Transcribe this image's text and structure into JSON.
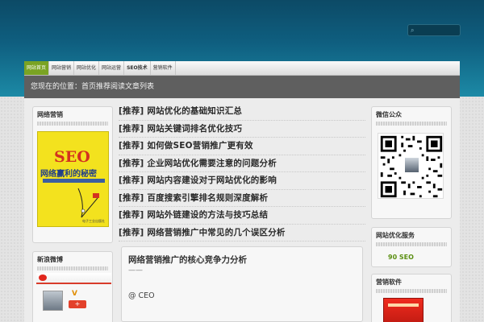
{
  "search": {
    "placeholder": "",
    "icon": "search-icon"
  },
  "nav": {
    "items": [
      {
        "label": "网站首页",
        "active": true
      },
      {
        "label": "网站营销"
      },
      {
        "label": "网站优化"
      },
      {
        "label": "网站运营"
      },
      {
        "label": "SEO技术",
        "bold": true
      },
      {
        "label": "营销软件"
      }
    ]
  },
  "banner": {
    "text": "您现在的位置：首页推荐阅读文章列表"
  },
  "left": {
    "book_widget": {
      "title": "网络营销",
      "book": {
        "big_text": "SEO",
        "title": "网络赢利的秘密",
        "publisher": "电子工业出版社"
      }
    },
    "weibo_widget": {
      "title": "新浪微博",
      "verified": "V",
      "follow_label": "+"
    }
  },
  "posts": [
    {
      "tag": "[推荐]",
      "title": "网站优化的基础知识汇总"
    },
    {
      "tag": "[推荐]",
      "title": "网站关键词排名优化技巧"
    },
    {
      "tag": "[推荐]",
      "title": "如何做SEO营销推广更有效"
    },
    {
      "tag": "[推荐]",
      "title": "企业网站优化需要注意的问题分析"
    },
    {
      "tag": "[推荐]",
      "title": "网站内容建设对于网站优化的影响"
    },
    {
      "tag": "[推荐]",
      "title": "百度搜索引擎排名规则深度解析"
    },
    {
      "tag": "[推荐]",
      "title": "网站外链建设的方法与技巧总结"
    },
    {
      "tag": "[推荐]",
      "title": "网络营销推广中常见的几个误区分析"
    }
  ],
  "article": {
    "title": "网络营销推广的核心竞争力分析",
    "dash": "——",
    "meta": "@ CEO"
  },
  "right": {
    "qr_widget": {
      "title": "微信公众"
    },
    "ad_widget": {
      "title": "网站优化服务",
      "text": "90 SEO"
    },
    "product_widget": {
      "title": "营销软件"
    }
  },
  "colors": {
    "header_top": "#0c4a66",
    "header_bottom": "#1c8aa6",
    "nav_active": "#7aa323",
    "banner": "#5f5f5f",
    "ad_text": "#5b8f12",
    "weibo_red": "#e1261c"
  }
}
